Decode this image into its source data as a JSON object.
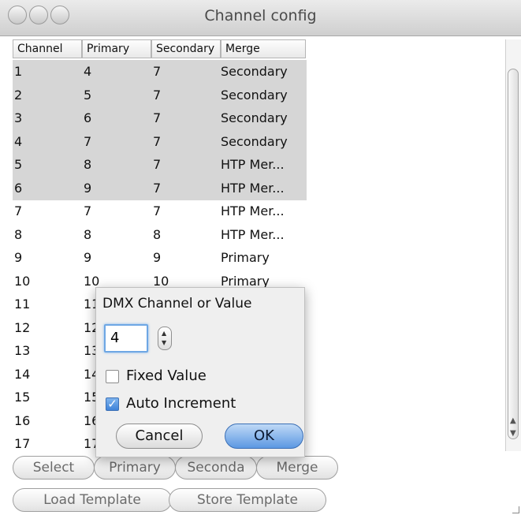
{
  "window": {
    "title": "Channel config"
  },
  "table": {
    "headers": [
      "Channel",
      "Primary",
      "Secondary",
      "Merge"
    ],
    "rows": [
      {
        "channel": "1",
        "primary": "4",
        "secondary": "7",
        "merge": "Secondary",
        "selected": true
      },
      {
        "channel": "2",
        "primary": "5",
        "secondary": "7",
        "merge": "Secondary",
        "selected": true
      },
      {
        "channel": "3",
        "primary": "6",
        "secondary": "7",
        "merge": "Secondary",
        "selected": true
      },
      {
        "channel": "4",
        "primary": "7",
        "secondary": "7",
        "merge": "Secondary",
        "selected": true
      },
      {
        "channel": "5",
        "primary": "8",
        "secondary": "7",
        "merge": "HTP Mer...",
        "selected": true
      },
      {
        "channel": "6",
        "primary": "9",
        "secondary": "7",
        "merge": "HTP Mer...",
        "selected": true
      },
      {
        "channel": "7",
        "primary": "7",
        "secondary": "7",
        "merge": "HTP Mer...",
        "selected": false
      },
      {
        "channel": "8",
        "primary": "8",
        "secondary": "8",
        "merge": "HTP Mer...",
        "selected": false
      },
      {
        "channel": "9",
        "primary": "9",
        "secondary": "9",
        "merge": "Primary",
        "selected": false
      },
      {
        "channel": "10",
        "primary": "10",
        "secondary": "10",
        "merge": "Primary",
        "selected": false
      },
      {
        "channel": "11",
        "primary": "11",
        "secondary": "",
        "merge": "",
        "selected": false
      },
      {
        "channel": "12",
        "primary": "12",
        "secondary": "",
        "merge": "",
        "selected": false
      },
      {
        "channel": "13",
        "primary": "13",
        "secondary": "",
        "merge": "",
        "selected": false
      },
      {
        "channel": "14",
        "primary": "14",
        "secondary": "",
        "merge": "",
        "selected": false
      },
      {
        "channel": "15",
        "primary": "15",
        "secondary": "",
        "merge": "",
        "selected": false
      },
      {
        "channel": "16",
        "primary": "16",
        "secondary": "",
        "merge": "",
        "selected": false
      },
      {
        "channel": "17",
        "primary": "17",
        "secondary": "",
        "merge": "",
        "selected": false
      }
    ]
  },
  "toolbar": {
    "select": "Select",
    "primary": "Primary",
    "secondary": "Seconda",
    "merge": "Merge",
    "load_template": "Load Template",
    "store_template": "Store Template"
  },
  "popup": {
    "title": "DMX Channel or Value",
    "value": "4",
    "fixed_value_label": "Fixed Value",
    "fixed_value_checked": false,
    "auto_increment_label": "Auto Increment",
    "auto_increment_checked": true,
    "cancel_label": "Cancel",
    "ok_label": "OK"
  },
  "colors": {
    "selection": "#d6d6d6",
    "accent": "#5c98e2"
  }
}
